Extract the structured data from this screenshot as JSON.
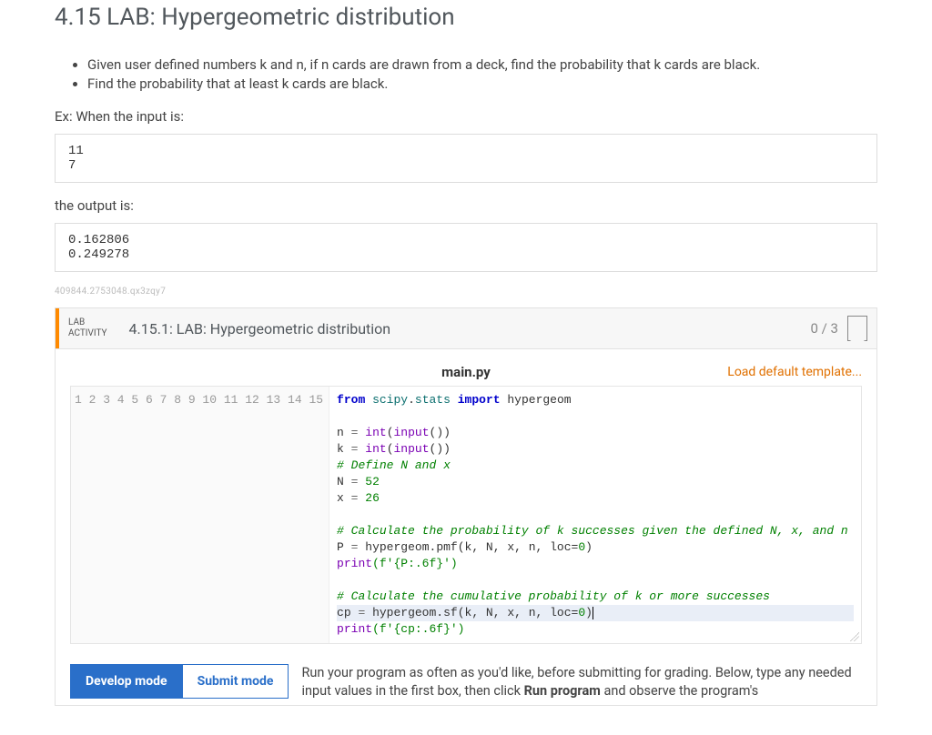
{
  "section": {
    "number": "4.15",
    "title": "LAB: Hypergeometric distribution"
  },
  "bullets": [
    "Given user defined numbers k and n, if n cards are drawn from a deck, find the probability that k cards are black.",
    "Find the probability that at least k cards are black."
  ],
  "example": {
    "input_label": "Ex: When the input is:",
    "input_text": "11\n7",
    "output_label": "the output is:",
    "output_text": "0.162806\n0.249278"
  },
  "id_stamp": "409844.2753048.qx3zqy7",
  "activity": {
    "tag_line1": "LAB",
    "tag_line2": "ACTIVITY",
    "number": "4.15.1:",
    "title": "LAB: Hypergeometric distribution",
    "score": "0 / 3"
  },
  "editor": {
    "filename": "main.py",
    "load_default": "Load default template...",
    "lines": 15
  },
  "code": {
    "l1_from": "from",
    "l1_mod1": "scipy",
    "l1_dot": ".",
    "l1_mod2": "stats",
    "l1_import": "import",
    "l1_hg": "hypergeom",
    "l3_var": "n ",
    "l3_eq": "=",
    "l3_int": " int",
    "l3_paren": "(",
    "l3_input": "input",
    "l3_close": "())",
    "l4_var": "k ",
    "l5_com": "# Define N and x",
    "l6_var": "N ",
    "l6_num": "52",
    "l7_var": "x ",
    "l7_num": "26",
    "l9_com": "# Calculate the probability of k successes given the defined N, x, and n",
    "l10_var": "P ",
    "l10_hg": "hypergeom",
    "l10_pmf": "pmf",
    "l10_args": "(k, N, x, n, loc=",
    "l10_zero": "0",
    "l10_end": ")",
    "l11_print": "print",
    "l11_arg": "(f'{P:.6f}')",
    "l13_com": "# Calculate the cumulative probability of k or more successes",
    "l14_var": "cp ",
    "l14_sf": "sf",
    "l14_close": ")",
    "l15_arg": "(f'{cp:.6f}')"
  },
  "bottom": {
    "develop": "Develop mode",
    "submit": "Submit mode",
    "instr_pre": "Run your program as often as you'd like, before submitting for grading. Below, type any needed input values in the first box, then click ",
    "instr_bold": "Run program",
    "instr_post": " and observe the program's"
  }
}
